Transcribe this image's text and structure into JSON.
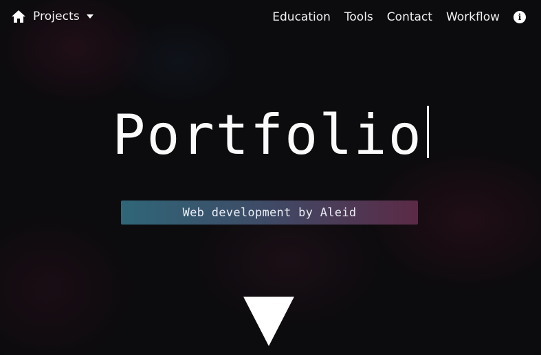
{
  "navbar": {
    "home_icon": "home-icon",
    "projects_label": "Projects",
    "projects_caret_icon": "caret-down-icon",
    "links": [
      {
        "label": "Education"
      },
      {
        "label": "Tools"
      },
      {
        "label": "Contact"
      },
      {
        "label": "Workflow"
      }
    ],
    "info_icon": "info-icon",
    "info_glyph": "i"
  },
  "hero": {
    "title": "Portfolio",
    "subtitle": "Web development by Aleid",
    "scroll_icon": "down-triangle-icon"
  },
  "colors": {
    "background": "#0c0b0e",
    "text": "#ffffff",
    "subtitle_gradient_start": "#2f6678",
    "subtitle_gradient_end": "#5b2a46"
  }
}
